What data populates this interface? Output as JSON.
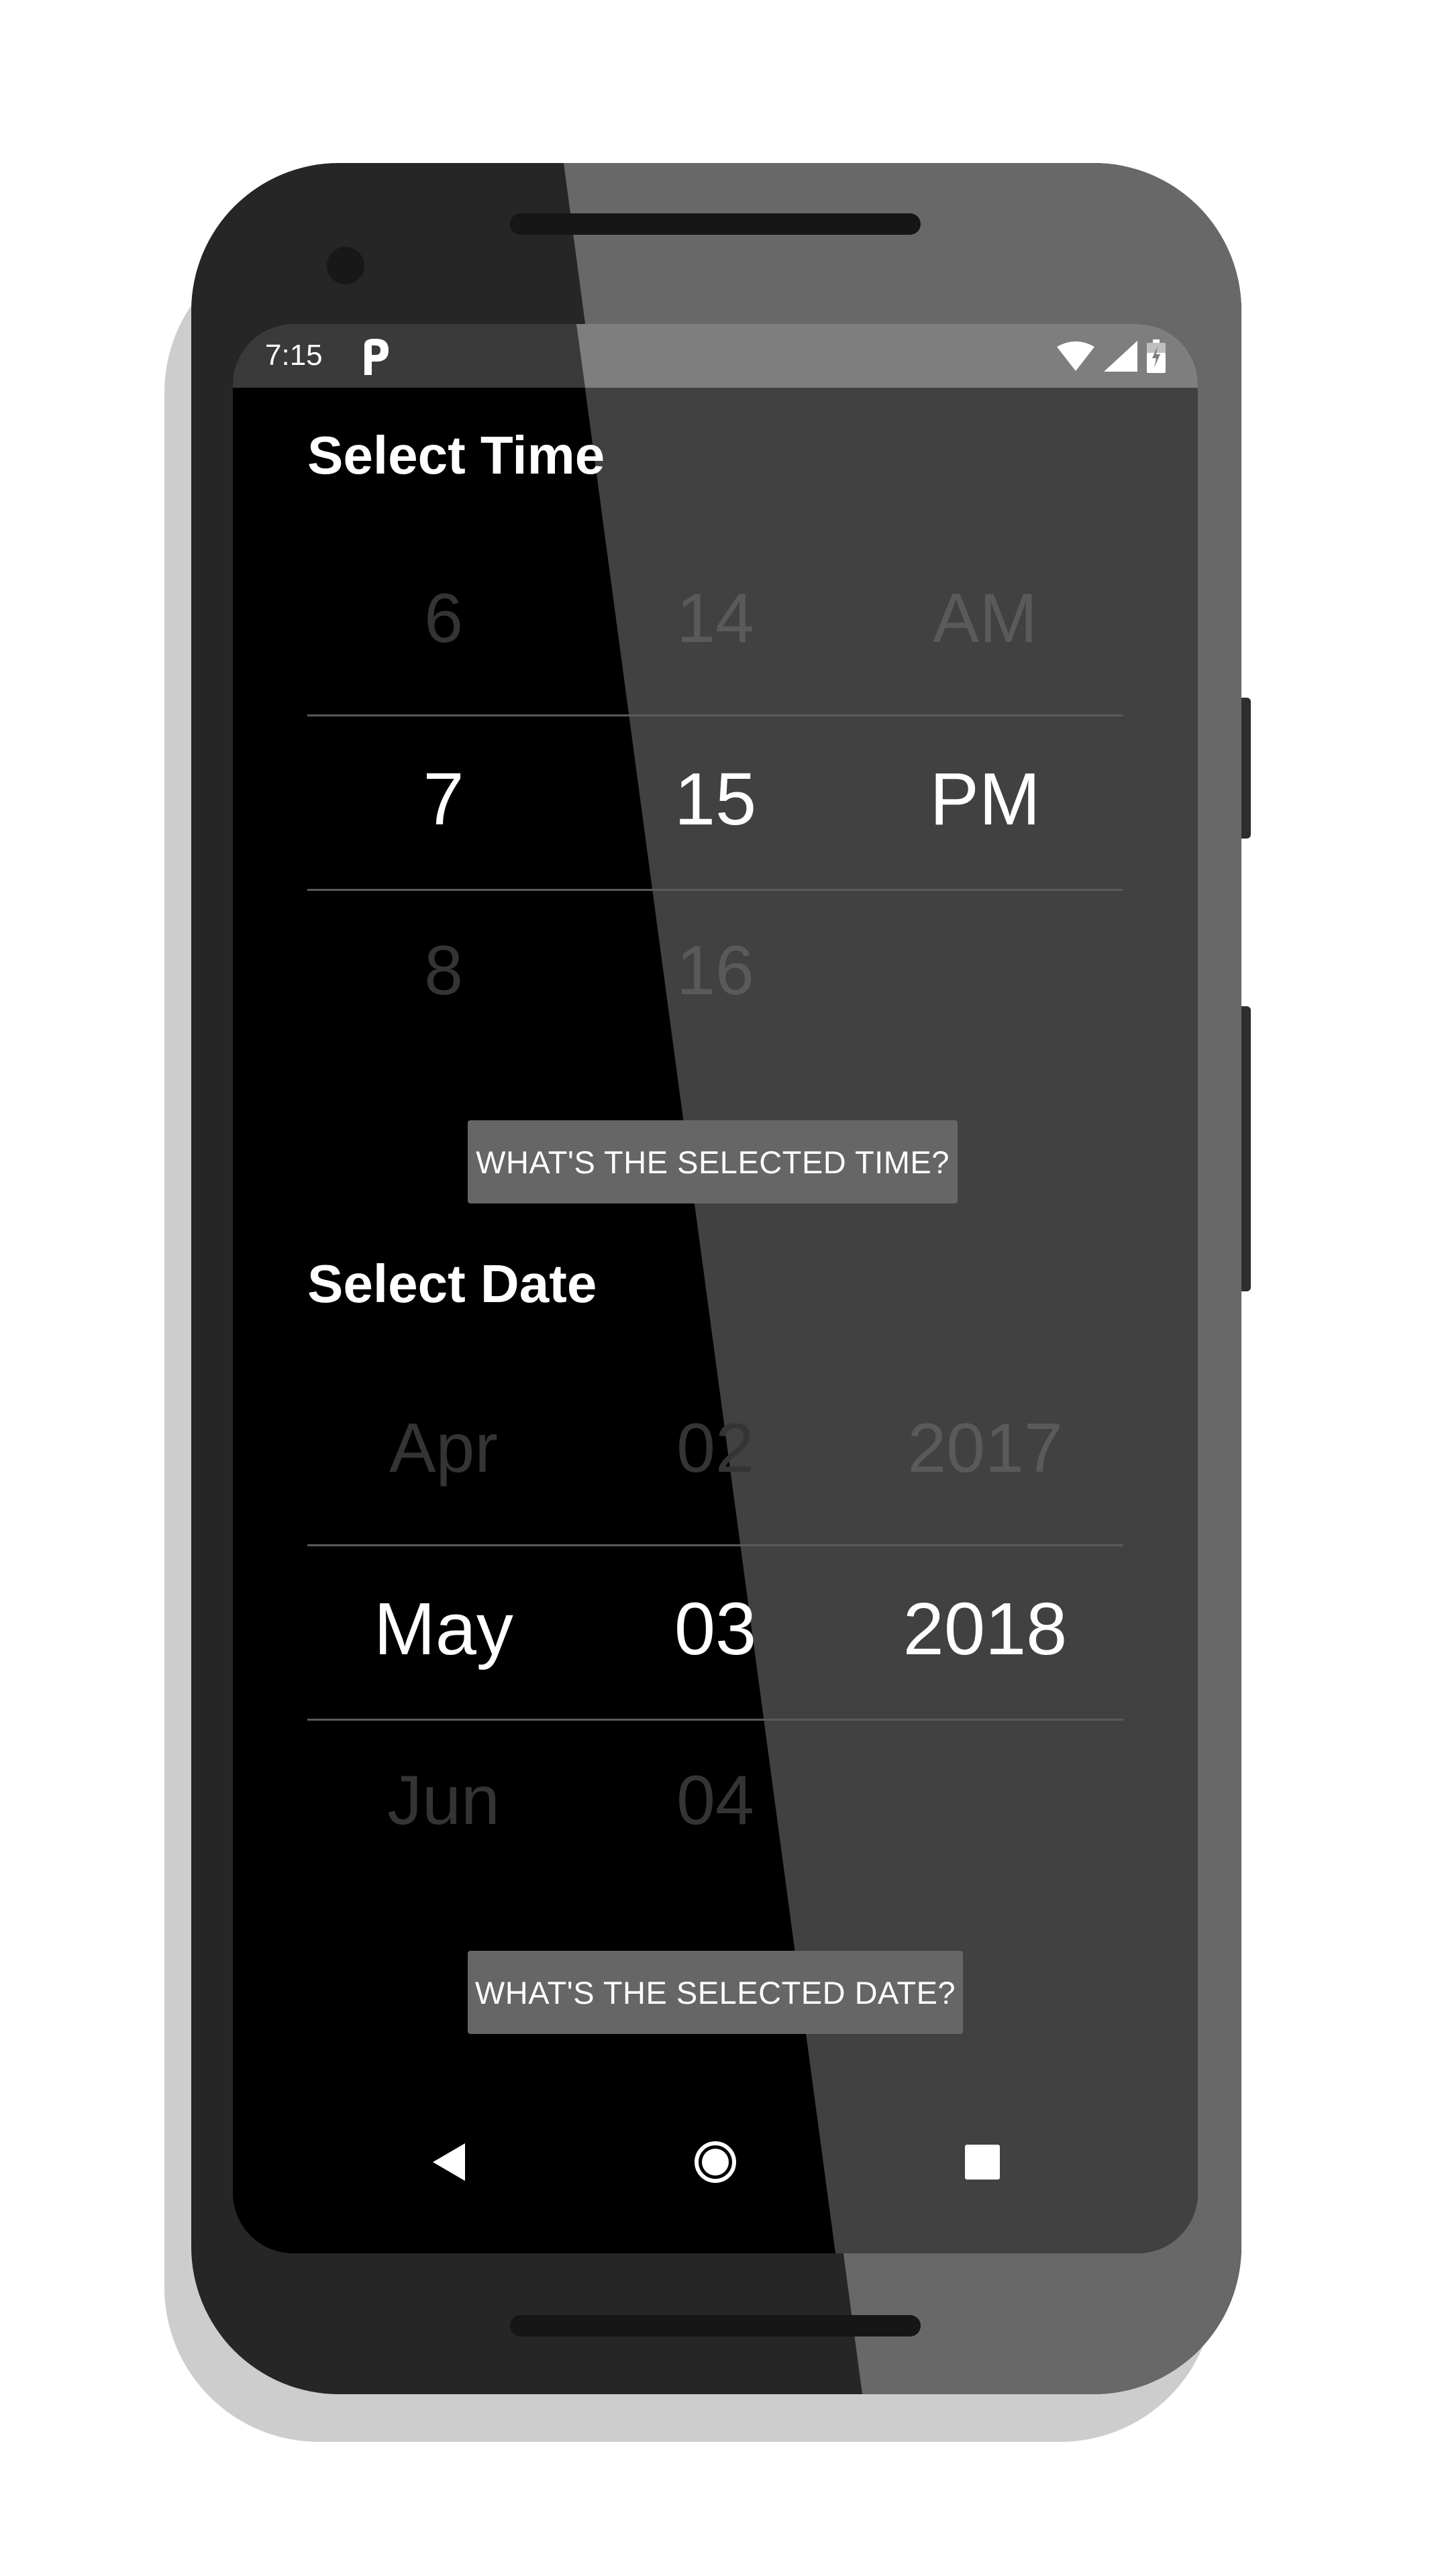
{
  "status_bar": {
    "time": "7:15",
    "notification_icon": "parking-p-icon",
    "icons": [
      "wifi-icon",
      "cell-signal-icon",
      "battery-charging-icon"
    ]
  },
  "time_section": {
    "title": "Select Time",
    "columns": [
      {
        "prev": "6",
        "selected": "7",
        "next": "8"
      },
      {
        "prev": "14",
        "selected": "15",
        "next": "16"
      },
      {
        "prev": "AM",
        "selected": "PM",
        "next": ""
      }
    ],
    "button_label": "WHAT'S THE SELECTED TIME?"
  },
  "date_section": {
    "title": "Select Date",
    "columns": [
      {
        "prev": "Apr",
        "selected": "May",
        "next": "Jun"
      },
      {
        "prev": "02",
        "selected": "03",
        "next": "04"
      },
      {
        "prev": "2017",
        "selected": "2018",
        "next": ""
      }
    ],
    "button_label": "WHAT'S THE SELECTED DATE?"
  },
  "nav_bar": {
    "buttons": [
      "back-triangle-icon",
      "home-circle-icon",
      "recents-square-icon"
    ]
  }
}
